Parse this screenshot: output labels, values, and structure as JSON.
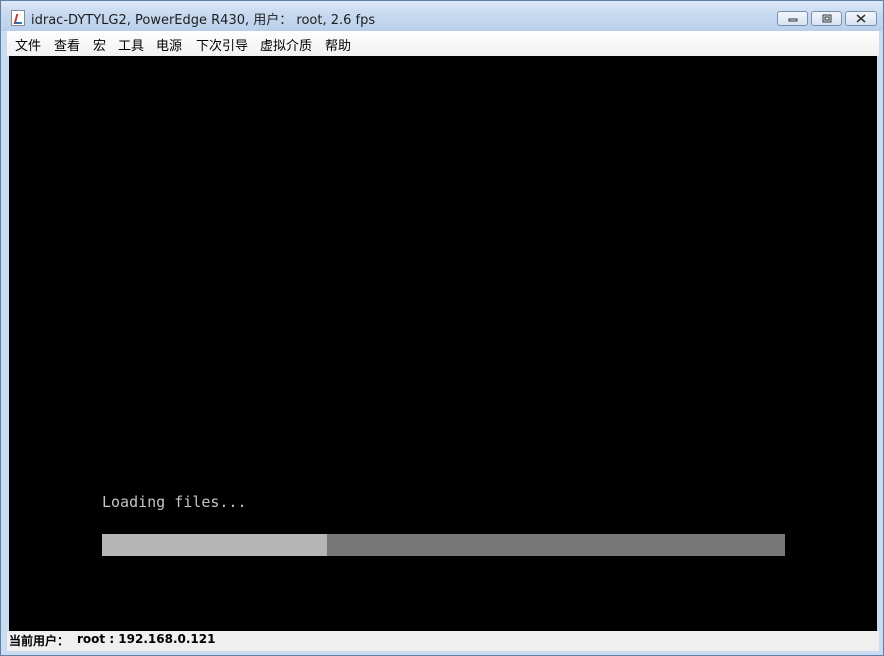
{
  "window": {
    "title": "idrac-DYTYLG2, PowerEdge R430, 用户： root, 2.6 fps",
    "icon": "java-app-icon",
    "controls": {
      "minimize": "minimize-icon",
      "maximize": "maximize-icon",
      "close": "close-icon"
    }
  },
  "menu": {
    "items": [
      "文件",
      "查看",
      "宏",
      "工具",
      "电源",
      "下次引导",
      "虚拟介质",
      "帮助"
    ]
  },
  "console": {
    "text": "Loading files...",
    "progress": 0.33,
    "colors": {
      "background": "#000000",
      "text": "#c4c4c4",
      "track": "#777777",
      "fill": "#b5b5b5"
    }
  },
  "status": {
    "label": "当前用户：",
    "value": "root : 192.168.0.121"
  }
}
